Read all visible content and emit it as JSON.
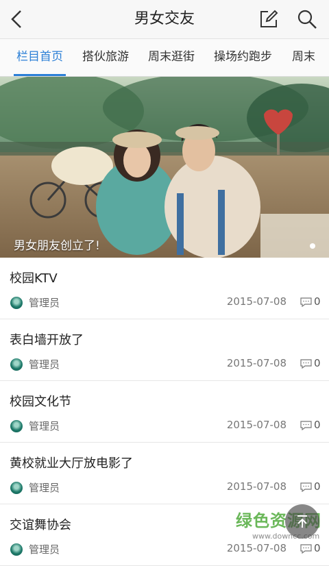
{
  "header": {
    "title": "男女交友",
    "back_icon": "back-arrow-icon",
    "compose_icon": "compose-icon",
    "search_icon": "search-icon"
  },
  "tabs": [
    {
      "label": "栏目首页",
      "active": true
    },
    {
      "label": "搭伙旅游",
      "active": false
    },
    {
      "label": "周末逛街",
      "active": false
    },
    {
      "label": "操场约跑步",
      "active": false
    },
    {
      "label": "周末",
      "active": false
    }
  ],
  "banner": {
    "caption": "男女朋友创立了!"
  },
  "posts": [
    {
      "title": "校园KTV",
      "author": "管理员",
      "date": "2015-07-08",
      "comments": "0"
    },
    {
      "title": "表白墙开放了",
      "author": "管理员",
      "date": "2015-07-08",
      "comments": "0"
    },
    {
      "title": "校园文化节",
      "author": "管理员",
      "date": "2015-07-08",
      "comments": "0"
    },
    {
      "title": "黄校就业大厅放电影了",
      "author": "管理员",
      "date": "2015-07-08",
      "comments": "0"
    },
    {
      "title": "交谊舞协会",
      "author": "管理员",
      "date": "2015-07-08",
      "comments": "0"
    }
  ],
  "watermark": {
    "text": "绿色资源网",
    "url": "www.downcc.com"
  },
  "colors": {
    "accent": "#2b7fd6",
    "header_bg": "#f7f7f7"
  }
}
